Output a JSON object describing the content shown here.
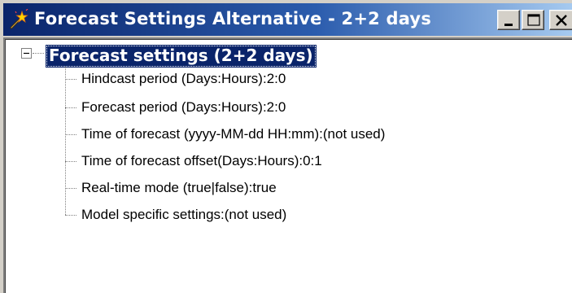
{
  "window": {
    "title": "Forecast Settings Alternative - 2+2 days",
    "icon": "magic-wand-icon",
    "controls": {
      "minimize": "minimize-icon",
      "maximize": "maximize-icon",
      "close": "close-icon"
    }
  },
  "tree": {
    "root": {
      "label": "Forecast settings (2+2 days)",
      "expanded": true,
      "selected": true,
      "expander_icon": "minus-icon"
    },
    "children": [
      {
        "label": "Hindcast period (Days:Hours):2:0"
      },
      {
        "label": "Forecast period (Days:Hours):2:0"
      },
      {
        "label": "Time of forecast (yyyy-MM-dd HH:mm):(not used)"
      },
      {
        "label": "Time of forecast offset(Days:Hours):0:1"
      },
      {
        "label": "Real-time mode (true|false):true"
      },
      {
        "label": "Model specific settings:(not used)"
      }
    ]
  },
  "colors": {
    "titlebar_start": "#0a246a",
    "titlebar_end": "#a6caf0",
    "selection": "#0a246a",
    "face": "#d4d0c8"
  }
}
